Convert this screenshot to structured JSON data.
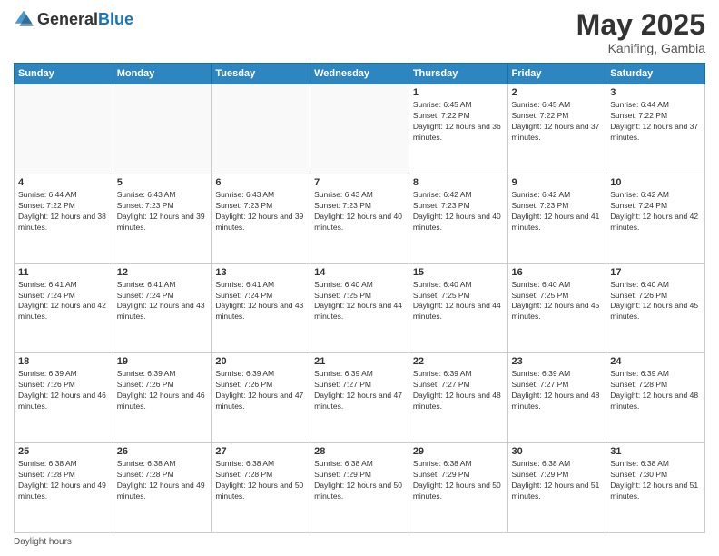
{
  "header": {
    "logo_general": "General",
    "logo_blue": "Blue",
    "month_year": "May 2025",
    "location": "Kanifing, Gambia"
  },
  "days_of_week": [
    "Sunday",
    "Monday",
    "Tuesday",
    "Wednesday",
    "Thursday",
    "Friday",
    "Saturday"
  ],
  "footer": {
    "label": "Daylight hours"
  },
  "weeks": [
    [
      {
        "day": "",
        "info": ""
      },
      {
        "day": "",
        "info": ""
      },
      {
        "day": "",
        "info": ""
      },
      {
        "day": "",
        "info": ""
      },
      {
        "day": "1",
        "sunrise": "Sunrise: 6:45 AM",
        "sunset": "Sunset: 7:22 PM",
        "daylight": "Daylight: 12 hours and 36 minutes."
      },
      {
        "day": "2",
        "sunrise": "Sunrise: 6:45 AM",
        "sunset": "Sunset: 7:22 PM",
        "daylight": "Daylight: 12 hours and 37 minutes."
      },
      {
        "day": "3",
        "sunrise": "Sunrise: 6:44 AM",
        "sunset": "Sunset: 7:22 PM",
        "daylight": "Daylight: 12 hours and 37 minutes."
      }
    ],
    [
      {
        "day": "4",
        "sunrise": "Sunrise: 6:44 AM",
        "sunset": "Sunset: 7:22 PM",
        "daylight": "Daylight: 12 hours and 38 minutes."
      },
      {
        "day": "5",
        "sunrise": "Sunrise: 6:43 AM",
        "sunset": "Sunset: 7:23 PM",
        "daylight": "Daylight: 12 hours and 39 minutes."
      },
      {
        "day": "6",
        "sunrise": "Sunrise: 6:43 AM",
        "sunset": "Sunset: 7:23 PM",
        "daylight": "Daylight: 12 hours and 39 minutes."
      },
      {
        "day": "7",
        "sunrise": "Sunrise: 6:43 AM",
        "sunset": "Sunset: 7:23 PM",
        "daylight": "Daylight: 12 hours and 40 minutes."
      },
      {
        "day": "8",
        "sunrise": "Sunrise: 6:42 AM",
        "sunset": "Sunset: 7:23 PM",
        "daylight": "Daylight: 12 hours and 40 minutes."
      },
      {
        "day": "9",
        "sunrise": "Sunrise: 6:42 AM",
        "sunset": "Sunset: 7:23 PM",
        "daylight": "Daylight: 12 hours and 41 minutes."
      },
      {
        "day": "10",
        "sunrise": "Sunrise: 6:42 AM",
        "sunset": "Sunset: 7:24 PM",
        "daylight": "Daylight: 12 hours and 42 minutes."
      }
    ],
    [
      {
        "day": "11",
        "sunrise": "Sunrise: 6:41 AM",
        "sunset": "Sunset: 7:24 PM",
        "daylight": "Daylight: 12 hours and 42 minutes."
      },
      {
        "day": "12",
        "sunrise": "Sunrise: 6:41 AM",
        "sunset": "Sunset: 7:24 PM",
        "daylight": "Daylight: 12 hours and 43 minutes."
      },
      {
        "day": "13",
        "sunrise": "Sunrise: 6:41 AM",
        "sunset": "Sunset: 7:24 PM",
        "daylight": "Daylight: 12 hours and 43 minutes."
      },
      {
        "day": "14",
        "sunrise": "Sunrise: 6:40 AM",
        "sunset": "Sunset: 7:25 PM",
        "daylight": "Daylight: 12 hours and 44 minutes."
      },
      {
        "day": "15",
        "sunrise": "Sunrise: 6:40 AM",
        "sunset": "Sunset: 7:25 PM",
        "daylight": "Daylight: 12 hours and 44 minutes."
      },
      {
        "day": "16",
        "sunrise": "Sunrise: 6:40 AM",
        "sunset": "Sunset: 7:25 PM",
        "daylight": "Daylight: 12 hours and 45 minutes."
      },
      {
        "day": "17",
        "sunrise": "Sunrise: 6:40 AM",
        "sunset": "Sunset: 7:26 PM",
        "daylight": "Daylight: 12 hours and 45 minutes."
      }
    ],
    [
      {
        "day": "18",
        "sunrise": "Sunrise: 6:39 AM",
        "sunset": "Sunset: 7:26 PM",
        "daylight": "Daylight: 12 hours and 46 minutes."
      },
      {
        "day": "19",
        "sunrise": "Sunrise: 6:39 AM",
        "sunset": "Sunset: 7:26 PM",
        "daylight": "Daylight: 12 hours and 46 minutes."
      },
      {
        "day": "20",
        "sunrise": "Sunrise: 6:39 AM",
        "sunset": "Sunset: 7:26 PM",
        "daylight": "Daylight: 12 hours and 47 minutes."
      },
      {
        "day": "21",
        "sunrise": "Sunrise: 6:39 AM",
        "sunset": "Sunset: 7:27 PM",
        "daylight": "Daylight: 12 hours and 47 minutes."
      },
      {
        "day": "22",
        "sunrise": "Sunrise: 6:39 AM",
        "sunset": "Sunset: 7:27 PM",
        "daylight": "Daylight: 12 hours and 48 minutes."
      },
      {
        "day": "23",
        "sunrise": "Sunrise: 6:39 AM",
        "sunset": "Sunset: 7:27 PM",
        "daylight": "Daylight: 12 hours and 48 minutes."
      },
      {
        "day": "24",
        "sunrise": "Sunrise: 6:39 AM",
        "sunset": "Sunset: 7:28 PM",
        "daylight": "Daylight: 12 hours and 48 minutes."
      }
    ],
    [
      {
        "day": "25",
        "sunrise": "Sunrise: 6:38 AM",
        "sunset": "Sunset: 7:28 PM",
        "daylight": "Daylight: 12 hours and 49 minutes."
      },
      {
        "day": "26",
        "sunrise": "Sunrise: 6:38 AM",
        "sunset": "Sunset: 7:28 PM",
        "daylight": "Daylight: 12 hours and 49 minutes."
      },
      {
        "day": "27",
        "sunrise": "Sunrise: 6:38 AM",
        "sunset": "Sunset: 7:28 PM",
        "daylight": "Daylight: 12 hours and 50 minutes."
      },
      {
        "day": "28",
        "sunrise": "Sunrise: 6:38 AM",
        "sunset": "Sunset: 7:29 PM",
        "daylight": "Daylight: 12 hours and 50 minutes."
      },
      {
        "day": "29",
        "sunrise": "Sunrise: 6:38 AM",
        "sunset": "Sunset: 7:29 PM",
        "daylight": "Daylight: 12 hours and 50 minutes."
      },
      {
        "day": "30",
        "sunrise": "Sunrise: 6:38 AM",
        "sunset": "Sunset: 7:29 PM",
        "daylight": "Daylight: 12 hours and 51 minutes."
      },
      {
        "day": "31",
        "sunrise": "Sunrise: 6:38 AM",
        "sunset": "Sunset: 7:30 PM",
        "daylight": "Daylight: 12 hours and 51 minutes."
      }
    ]
  ]
}
